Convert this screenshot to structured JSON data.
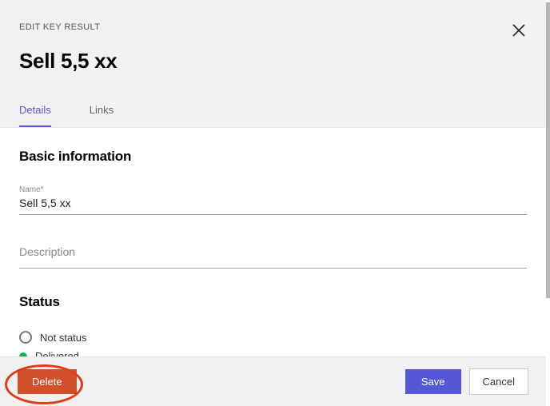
{
  "overline": "EDIT KEY RESULT",
  "title": "Sell 5,5 xx",
  "tabs": {
    "details": "Details",
    "links": "Links"
  },
  "sections": {
    "basic_title": "Basic information",
    "name_label": "Name*",
    "name_value": "Sell 5,5 xx",
    "description_placeholder": "Description",
    "status_title": "Status",
    "status_options": {
      "not_status": "Not status",
      "delivered": "Delivered"
    }
  },
  "footer": {
    "delete": "Delete",
    "save": "Save",
    "cancel": "Cancel"
  }
}
